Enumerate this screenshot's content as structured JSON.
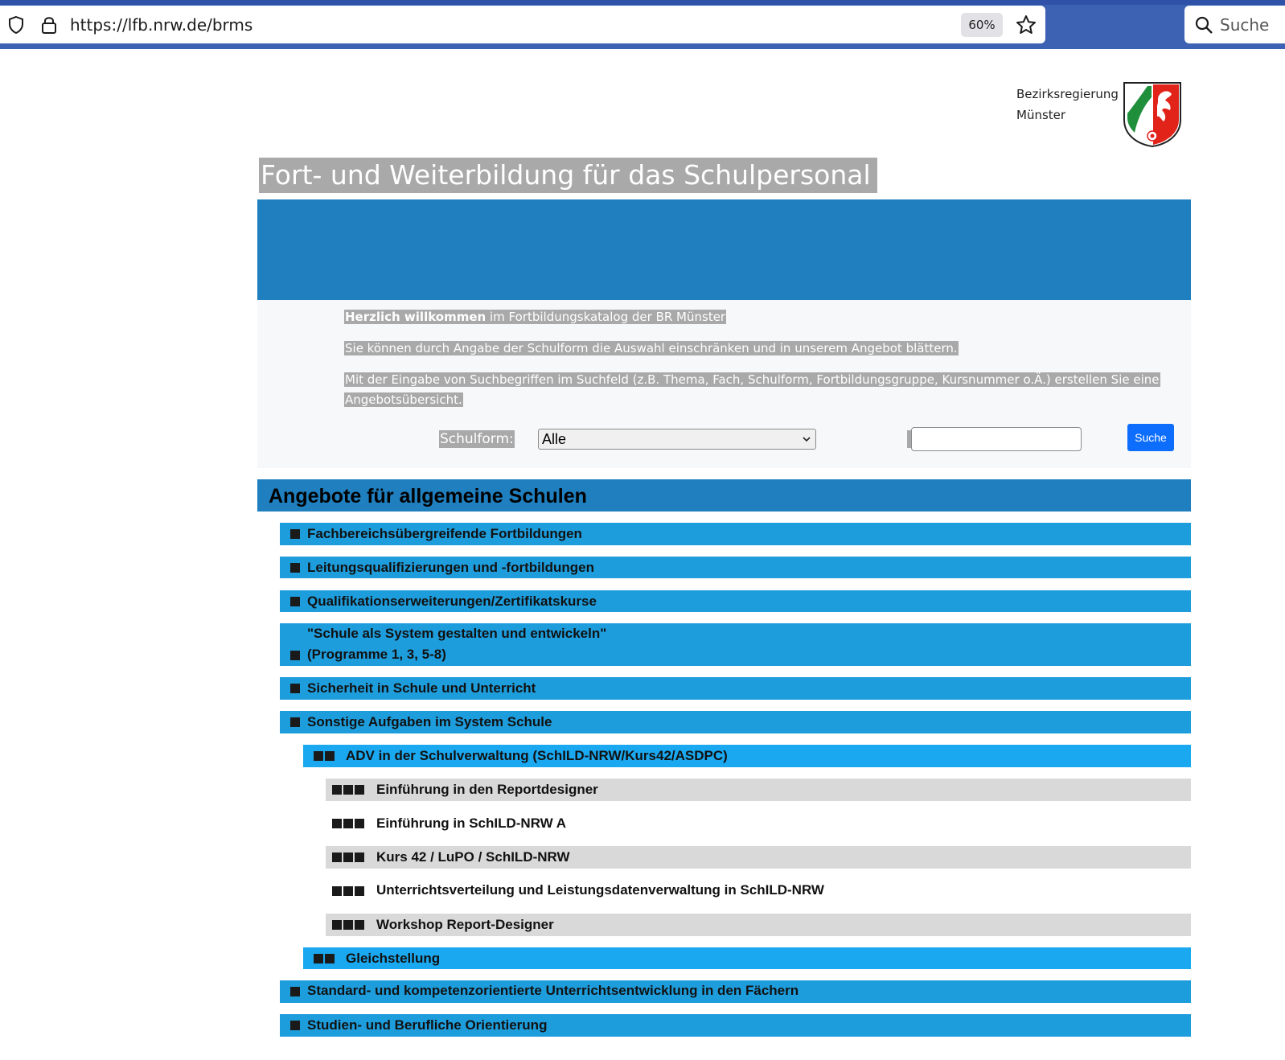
{
  "browser": {
    "url": "https://lfb.nrw.de/brms",
    "zoom": "60%",
    "search_placeholder": "Suche"
  },
  "header": {
    "org_line1": "Bezirksregierung",
    "org_line2": "Münster",
    "title": "Fort- und Weiterbildung für das Schulpersonal"
  },
  "intro": {
    "welcome_bold": "Herzlich willkommen",
    "welcome_rest": " im Fortbildungskatalog der BR Münster",
    "line2": "Sie können durch Angabe der Schulform die Auswahl einschränken und in unserem Angebot blättern.",
    "line3a": "Mit der Eingabe von Suchbegriffen im Suchfeld (z.B. Thema, Fach, Schulform, Fortbildungsgruppe, Kursnummer o.Ä.) erstellen Sie eine",
    "line3b": "Angebotsübersicht."
  },
  "filter": {
    "schulform_label": "Schulform:",
    "schulform_value": "Alle",
    "search_value": "",
    "search_button": "Suche"
  },
  "catalog": {
    "section_title": "Angebote für allgemeine Schulen",
    "items": [
      {
        "level": 1,
        "label": "Fachbereichsübergreifende Fortbildungen"
      },
      {
        "level": 1,
        "label": "Leitungsqualifizierungen und -fortbildungen"
      },
      {
        "level": 1,
        "label": "Qualifikationserweiterungen/Zertifikatskurse"
      },
      {
        "level": 1,
        "label": "\"Schule als System gestalten und entwickeln\"",
        "label2": "(Programme 1, 3, 5-8)"
      },
      {
        "level": 1,
        "label": "Sicherheit in Schule und Unterricht"
      },
      {
        "level": 1,
        "label": "Sonstige Aufgaben im System Schule"
      },
      {
        "level": 2,
        "label": "ADV in der Schulverwaltung (SchILD-NRW/Kurs42/ASDPC)"
      },
      {
        "level": 3,
        "label": "Einführung in den Reportdesigner"
      },
      {
        "level": 3,
        "label": "Einführung in SchILD-NRW A"
      },
      {
        "level": 3,
        "label": "Kurs 42 / LuPO / SchILD-NRW"
      },
      {
        "level": 3,
        "label": "Unterrichtsverteilung und Leistungsdatenverwaltung in SchILD-NRW"
      },
      {
        "level": 3,
        "label": "Workshop Report-Designer"
      },
      {
        "level": 2,
        "label": "Gleichstellung"
      },
      {
        "level": 1,
        "label": "Standard- und kompetenzorientierte Unterrichtsentwicklung in den Fächern"
      },
      {
        "level": 1,
        "label": "Studien- und Berufliche Orientierung"
      }
    ]
  },
  "colors": {
    "banner_blue": "#1f7fbf",
    "level1_blue": "#1e9ddd",
    "level2_blue": "#1aa8f0",
    "level3_grey": "#d9d9d9",
    "button_blue": "#0d6efd",
    "chrome_blue": "#3d62b3"
  }
}
